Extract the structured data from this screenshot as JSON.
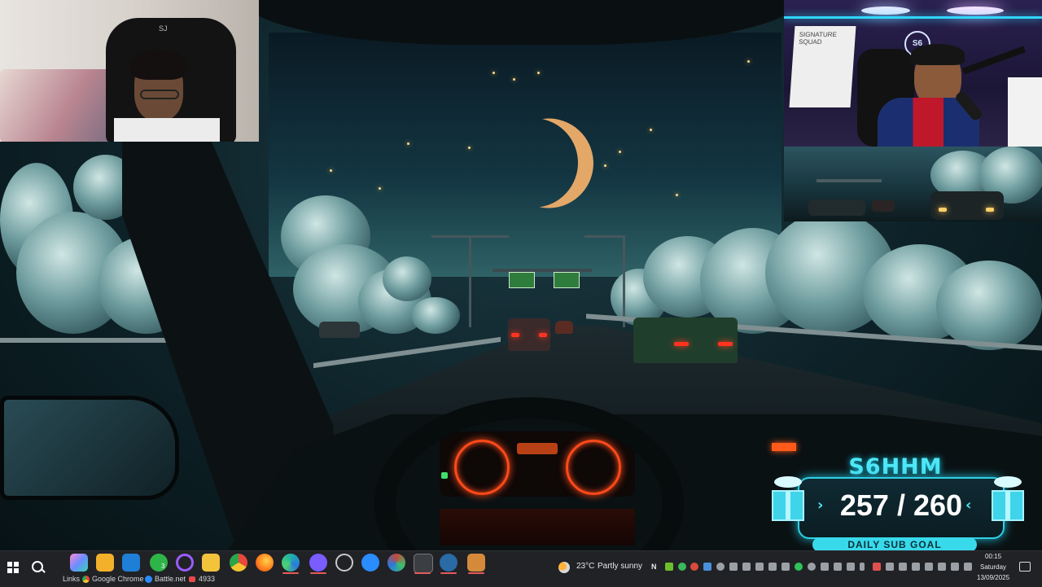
{
  "stream": {
    "goal": {
      "name": "S6HHM",
      "current": "257",
      "separator": "/",
      "target": "260",
      "label": "DAILY SUB GOAL",
      "progress_fraction": 0.988
    },
    "cam1_chair_logo": "SJ",
    "cam2_whiteboard": "SIGNATURE\nSQUAD",
    "cam2_logo": "S6"
  },
  "taskbar": {
    "apps": [
      {
        "name": "start-button",
        "color": "#ffffff"
      },
      {
        "name": "search-button",
        "color": "#ffffff"
      },
      {
        "name": "copilot-icon",
        "color": "#6b8cff"
      },
      {
        "name": "microsoft-store-icon",
        "color": "#f2b02b"
      },
      {
        "name": "outlook-icon",
        "color": "#1f7ed6"
      },
      {
        "name": "xbox-icon",
        "color": "#2fb44a"
      },
      {
        "name": "cortana-icon",
        "color": "#9b5cff"
      },
      {
        "name": "file-explorer-icon",
        "color": "#f3c33b"
      },
      {
        "name": "chrome-icon",
        "color": "#e8483b"
      },
      {
        "name": "firefox-icon",
        "color": "#ff7a1a"
      },
      {
        "name": "edge-icon",
        "color": "#1fb3a5"
      },
      {
        "name": "obs-icon",
        "color": "#7a5cff"
      },
      {
        "name": "clock-icon",
        "color": "#c9c9c9"
      },
      {
        "name": "battlenet-icon",
        "color": "#2a8cff"
      },
      {
        "name": "davinci-icon",
        "color": "#c24a3d"
      },
      {
        "name": "xbox-app-icon",
        "color": "#6d6d6d"
      },
      {
        "name": "steam-icon",
        "color": "#2a6aa5"
      },
      {
        "name": "game-icon",
        "color": "#d58a3b"
      }
    ],
    "xbox_badge": "3",
    "links_label": "Links",
    "link_items": [
      {
        "label": "Google Chrome",
        "icon": "chrome-icon"
      },
      {
        "label": "Battle.net",
        "icon": "battlenet-icon"
      },
      {
        "label": "4933",
        "icon": "ticket-icon"
      }
    ],
    "weather": {
      "temp": "23°C",
      "condition": "Partly sunny"
    },
    "tray_letter": "N",
    "time": "00:15",
    "day": "Saturday",
    "date": "13/09/2025"
  }
}
